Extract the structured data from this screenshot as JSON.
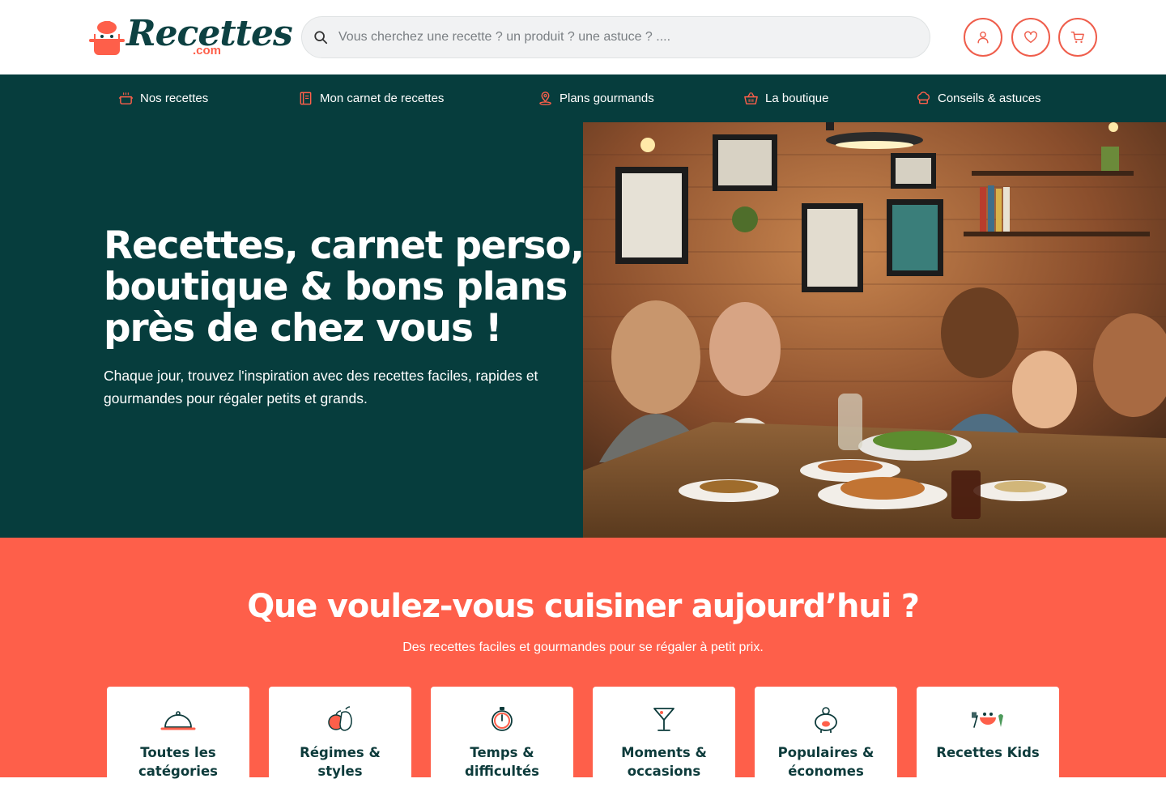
{
  "brand": {
    "logo_text": "Recettes",
    "logo_suffix": ".com"
  },
  "search": {
    "placeholder": "Vous cherchez une recette ? un produit ? une astuce ? ...."
  },
  "header_actions": [
    {
      "icon": "user-icon"
    },
    {
      "icon": "heart-icon"
    },
    {
      "icon": "cart-icon"
    }
  ],
  "nav": {
    "items": [
      {
        "label": "Nos recettes",
        "icon": "pot-icon"
      },
      {
        "label": "Mon carnet de recettes",
        "icon": "notebook-icon"
      },
      {
        "label": "Plans gourmands",
        "icon": "map-pin-icon"
      },
      {
        "label": "La boutique",
        "icon": "basket-icon"
      },
      {
        "label": "Conseils & astuces",
        "icon": "chef-hat-icon"
      }
    ]
  },
  "hero": {
    "title_line1": "Recettes, carnet perso,",
    "title_line2_a": "boutique & ",
    "title_line2_b": "bons plans",
    "title_line3": "près de chez vous !",
    "subtitle": "Chaque jour, trouvez l'inspiration avec des recettes faciles, rapides et gourmandes pour régaler petits et grands."
  },
  "categories": {
    "title": "Que voulez-vous cuisiner aujourd’hui ?",
    "subtitle": "Des recettes faciles et gourmandes pour se régaler à petit prix.",
    "items": [
      {
        "label": "Toutes les catégories",
        "icon": "cloche-icon"
      },
      {
        "label": "Régimes & styles",
        "icon": "vegetables-icon"
      },
      {
        "label": "Temps & difficultés",
        "icon": "stopwatch-icon"
      },
      {
        "label": "Moments & occasions",
        "icon": "cocktail-icon"
      },
      {
        "label": "Populaires & économes",
        "icon": "piggy-bank-icon"
      },
      {
        "label": "Recettes Kids",
        "icon": "kids-plate-icon"
      }
    ]
  },
  "colors": {
    "primary": "#063d3d",
    "accent": "#fe5f4a",
    "white": "#ffffff"
  }
}
